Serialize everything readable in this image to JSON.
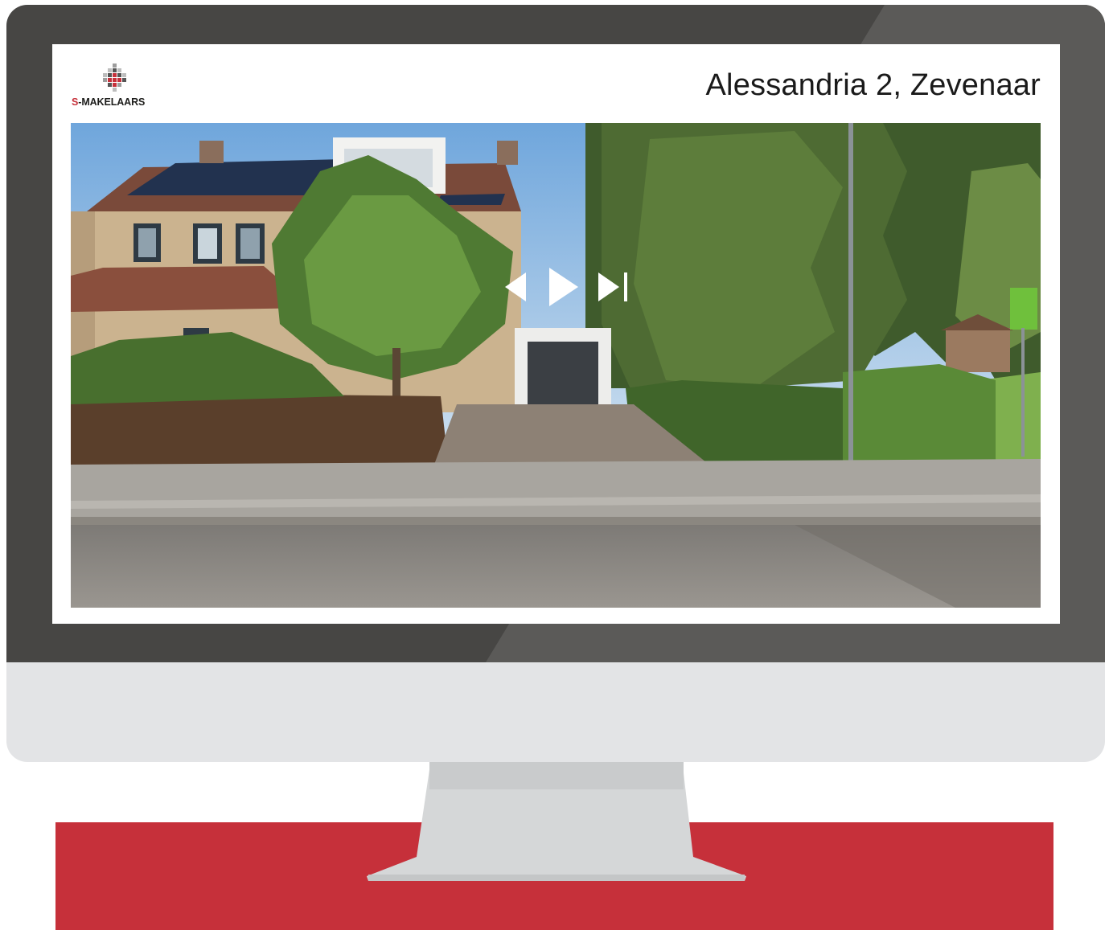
{
  "brand": {
    "logo_prefix": "S",
    "logo_suffix": "-MAKELAARS",
    "logo_name": "S-MAKELAARS"
  },
  "listing": {
    "address": "Alessandria 2, Zevenaar"
  },
  "player": {
    "previous_icon": "triangle-left-icon",
    "play_icon": "play-icon",
    "next_icon": "skip-next-icon"
  },
  "colors": {
    "bezel": "#474644",
    "chassis": "#e3e4e6",
    "stand": "#d5d7d8",
    "accent_red": "#c6303a",
    "screen_bg": "#ffffff"
  }
}
